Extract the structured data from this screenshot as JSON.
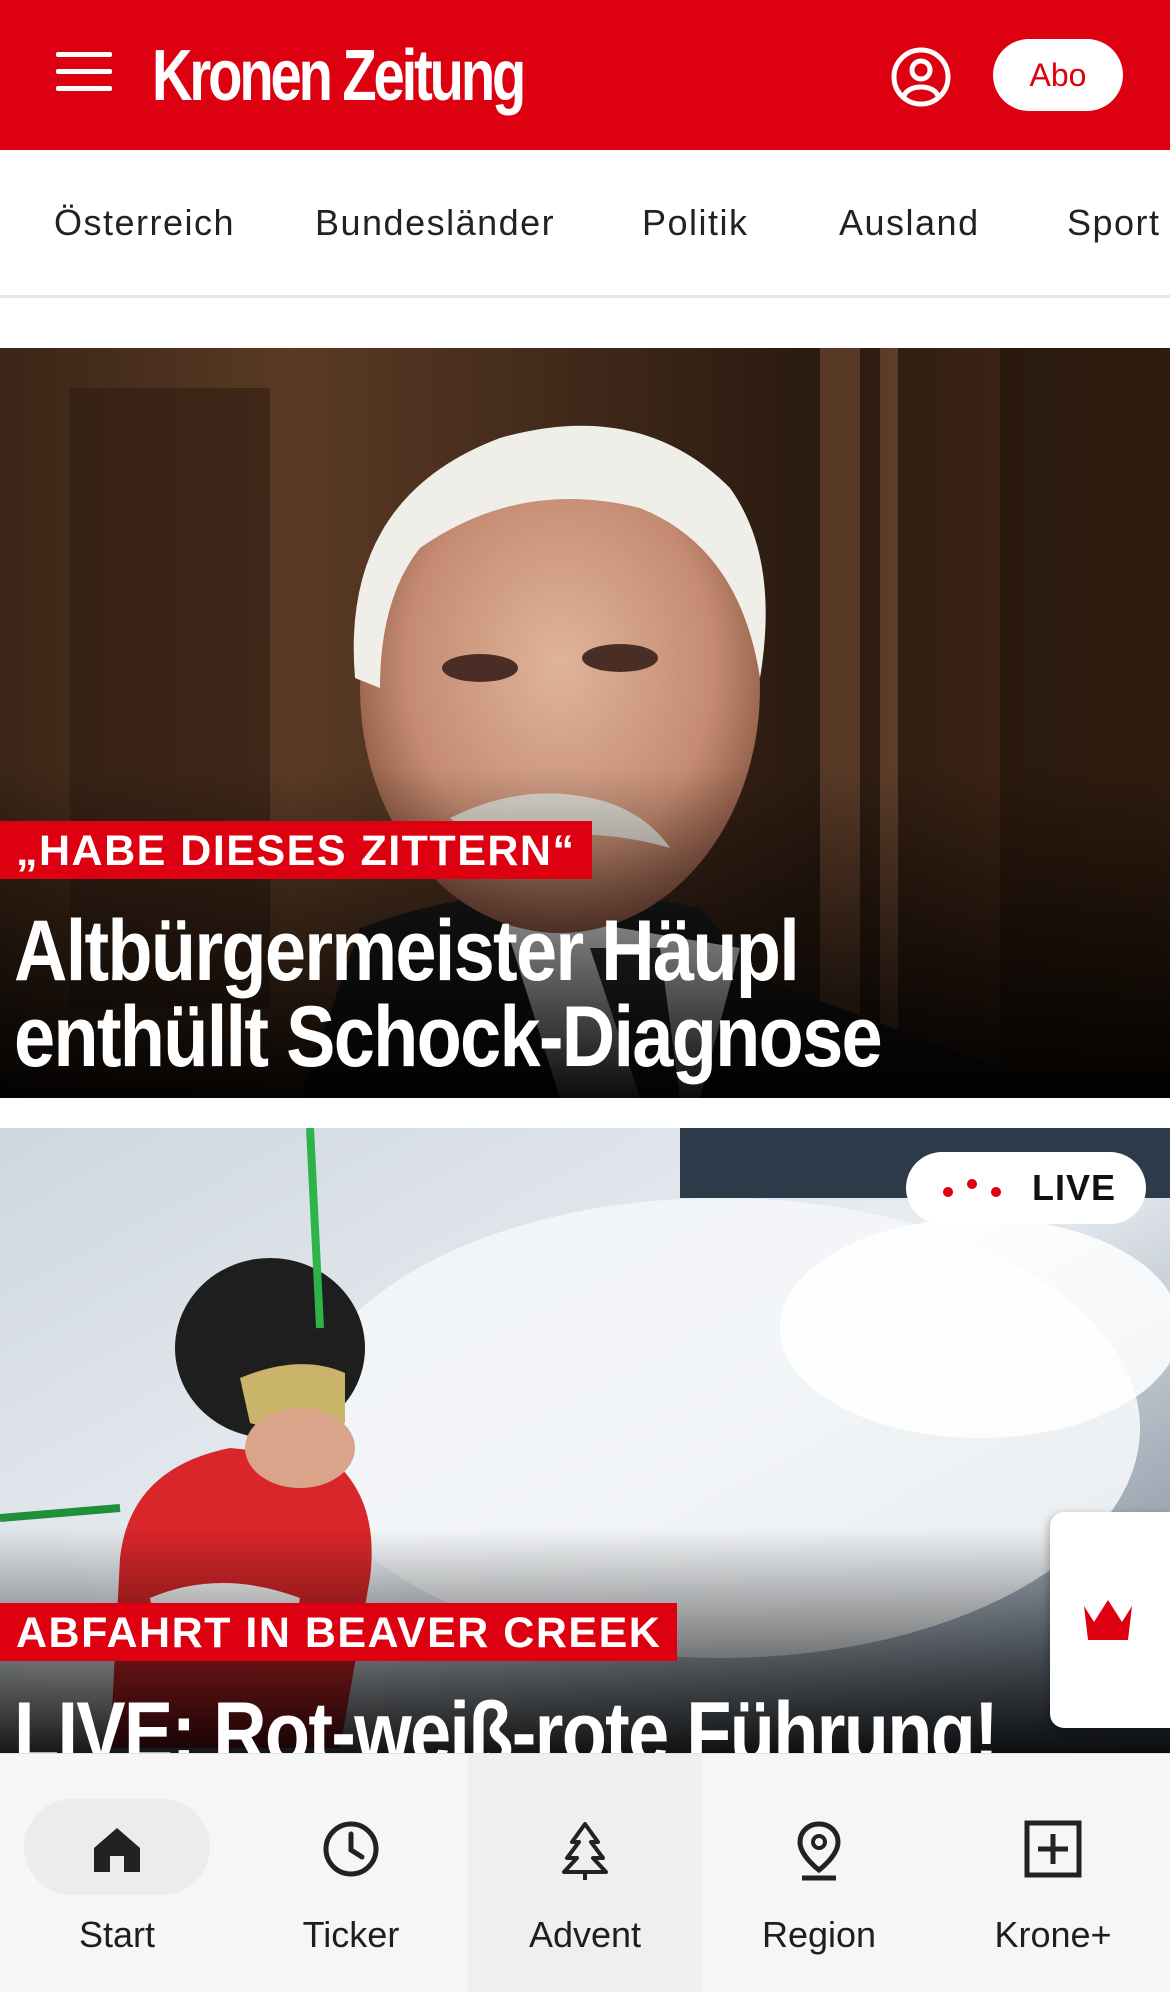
{
  "header": {
    "logo_text": "Kronen Zeitung",
    "abo_label": "Abo",
    "brand_color": "#dd0010"
  },
  "categories": [
    "Österreich",
    "Bundesländer",
    "Politik",
    "Ausland",
    "Sport"
  ],
  "articles": [
    {
      "kicker": "„HABE DIESES ZITTERN“",
      "headline_line1": "Altbürgermeister Häupl",
      "headline_line2": "enthüllt Schock-Diagnose"
    },
    {
      "badge": "LIVE",
      "kicker": "ABFAHRT IN BEAVER CREEK",
      "headline_line1": "LIVE: Rot-weiß-rote Führung!"
    }
  ],
  "bottom_nav": [
    {
      "label": "Start",
      "icon": "home-icon"
    },
    {
      "label": "Ticker",
      "icon": "clock-icon"
    },
    {
      "label": "Advent",
      "icon": "tree-icon"
    },
    {
      "label": "Region",
      "icon": "location-pin-icon"
    },
    {
      "label": "Krone+",
      "icon": "plus-square-icon"
    }
  ]
}
